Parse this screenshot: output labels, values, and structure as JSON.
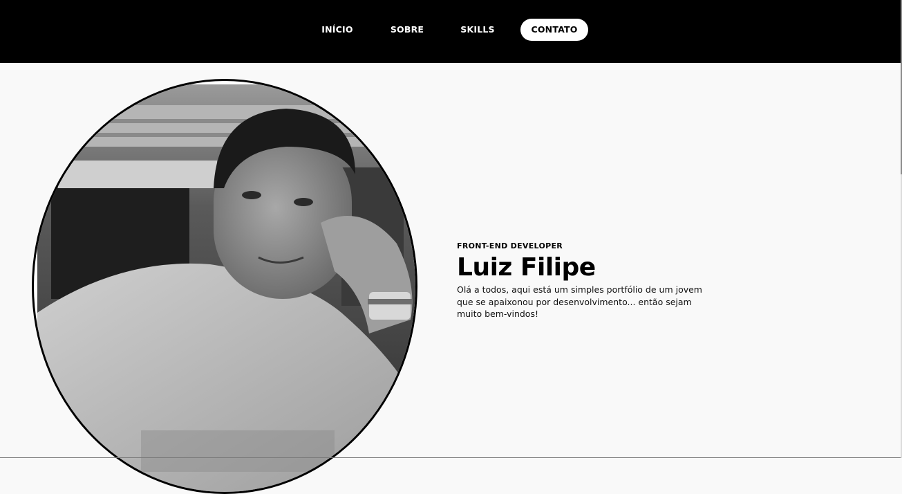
{
  "nav": {
    "items": [
      {
        "label": "INÍCIO"
      },
      {
        "label": "SOBRE"
      },
      {
        "label": "SKILLS"
      },
      {
        "label": "CONTATO",
        "active": true
      }
    ]
  },
  "hero": {
    "role": "FRONT-END DEVELOPER",
    "name": "Luiz Filipe",
    "intro": "Olá a todos, aqui está um simples portfólio de um jovem que se apaixonou por desenvolvimento... então sejam muito bem-vindos!",
    "photo_alt": "Black and white portrait photo"
  },
  "colors": {
    "navbar_bg": "#000000",
    "page_bg": "#f9f9f9",
    "active_pill": "#ffffff",
    "text": "#000000"
  }
}
